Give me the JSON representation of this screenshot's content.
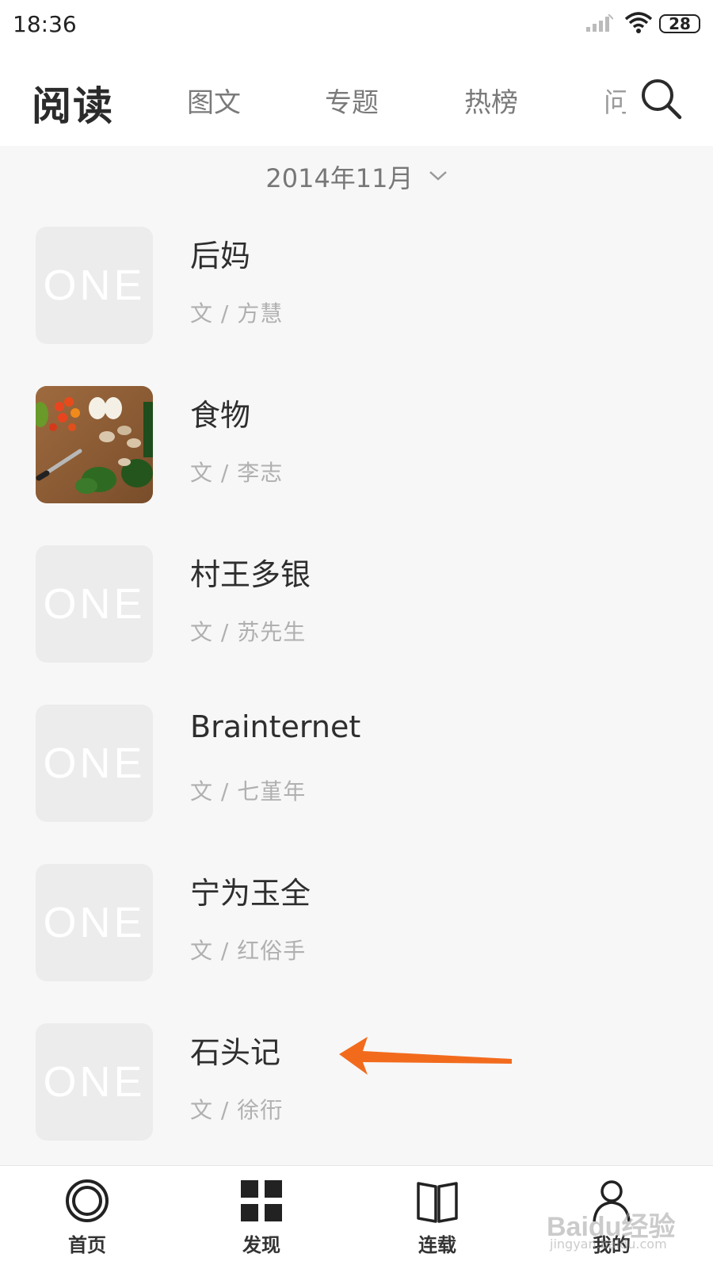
{
  "status_bar": {
    "time": "18:36",
    "battery": "28",
    "icons": [
      "signal-icon",
      "wifi-icon",
      "battery-icon"
    ]
  },
  "header": {
    "title": "阅读",
    "tabs": [
      {
        "label": "图文"
      },
      {
        "label": "专题"
      },
      {
        "label": "热榜"
      },
      {
        "label": "问"
      }
    ],
    "search_icon": "search-icon"
  },
  "date_selector": {
    "label": "2014年11月",
    "icon": "chevron-down-icon"
  },
  "articles": [
    {
      "title": "后妈",
      "author": "文 / 方慧",
      "thumb": "ONE"
    },
    {
      "title": "食物",
      "author": "文 / 李志",
      "thumb": "photo"
    },
    {
      "title": "村王多银",
      "author": "文 / 苏先生",
      "thumb": "ONE"
    },
    {
      "title": "Brainternet",
      "author": "文 / 七堇年",
      "thumb": "ONE"
    },
    {
      "title": "宁为玉全",
      "author": "文 / 红俗手",
      "thumb": "ONE"
    },
    {
      "title": "石头记",
      "author": "文 / 徐衎",
      "thumb": "ONE"
    }
  ],
  "annotation_arrow_color": "#f26b1d",
  "bottom_nav": [
    {
      "label": "首页",
      "icon": "home-ring-icon"
    },
    {
      "label": "发现",
      "icon": "grid-icon"
    },
    {
      "label": "连载",
      "icon": "book-icon"
    },
    {
      "label": "我的",
      "icon": "user-icon"
    }
  ],
  "watermark": {
    "text": "Baidu经验",
    "sub": "jingyan.baidu.com"
  }
}
